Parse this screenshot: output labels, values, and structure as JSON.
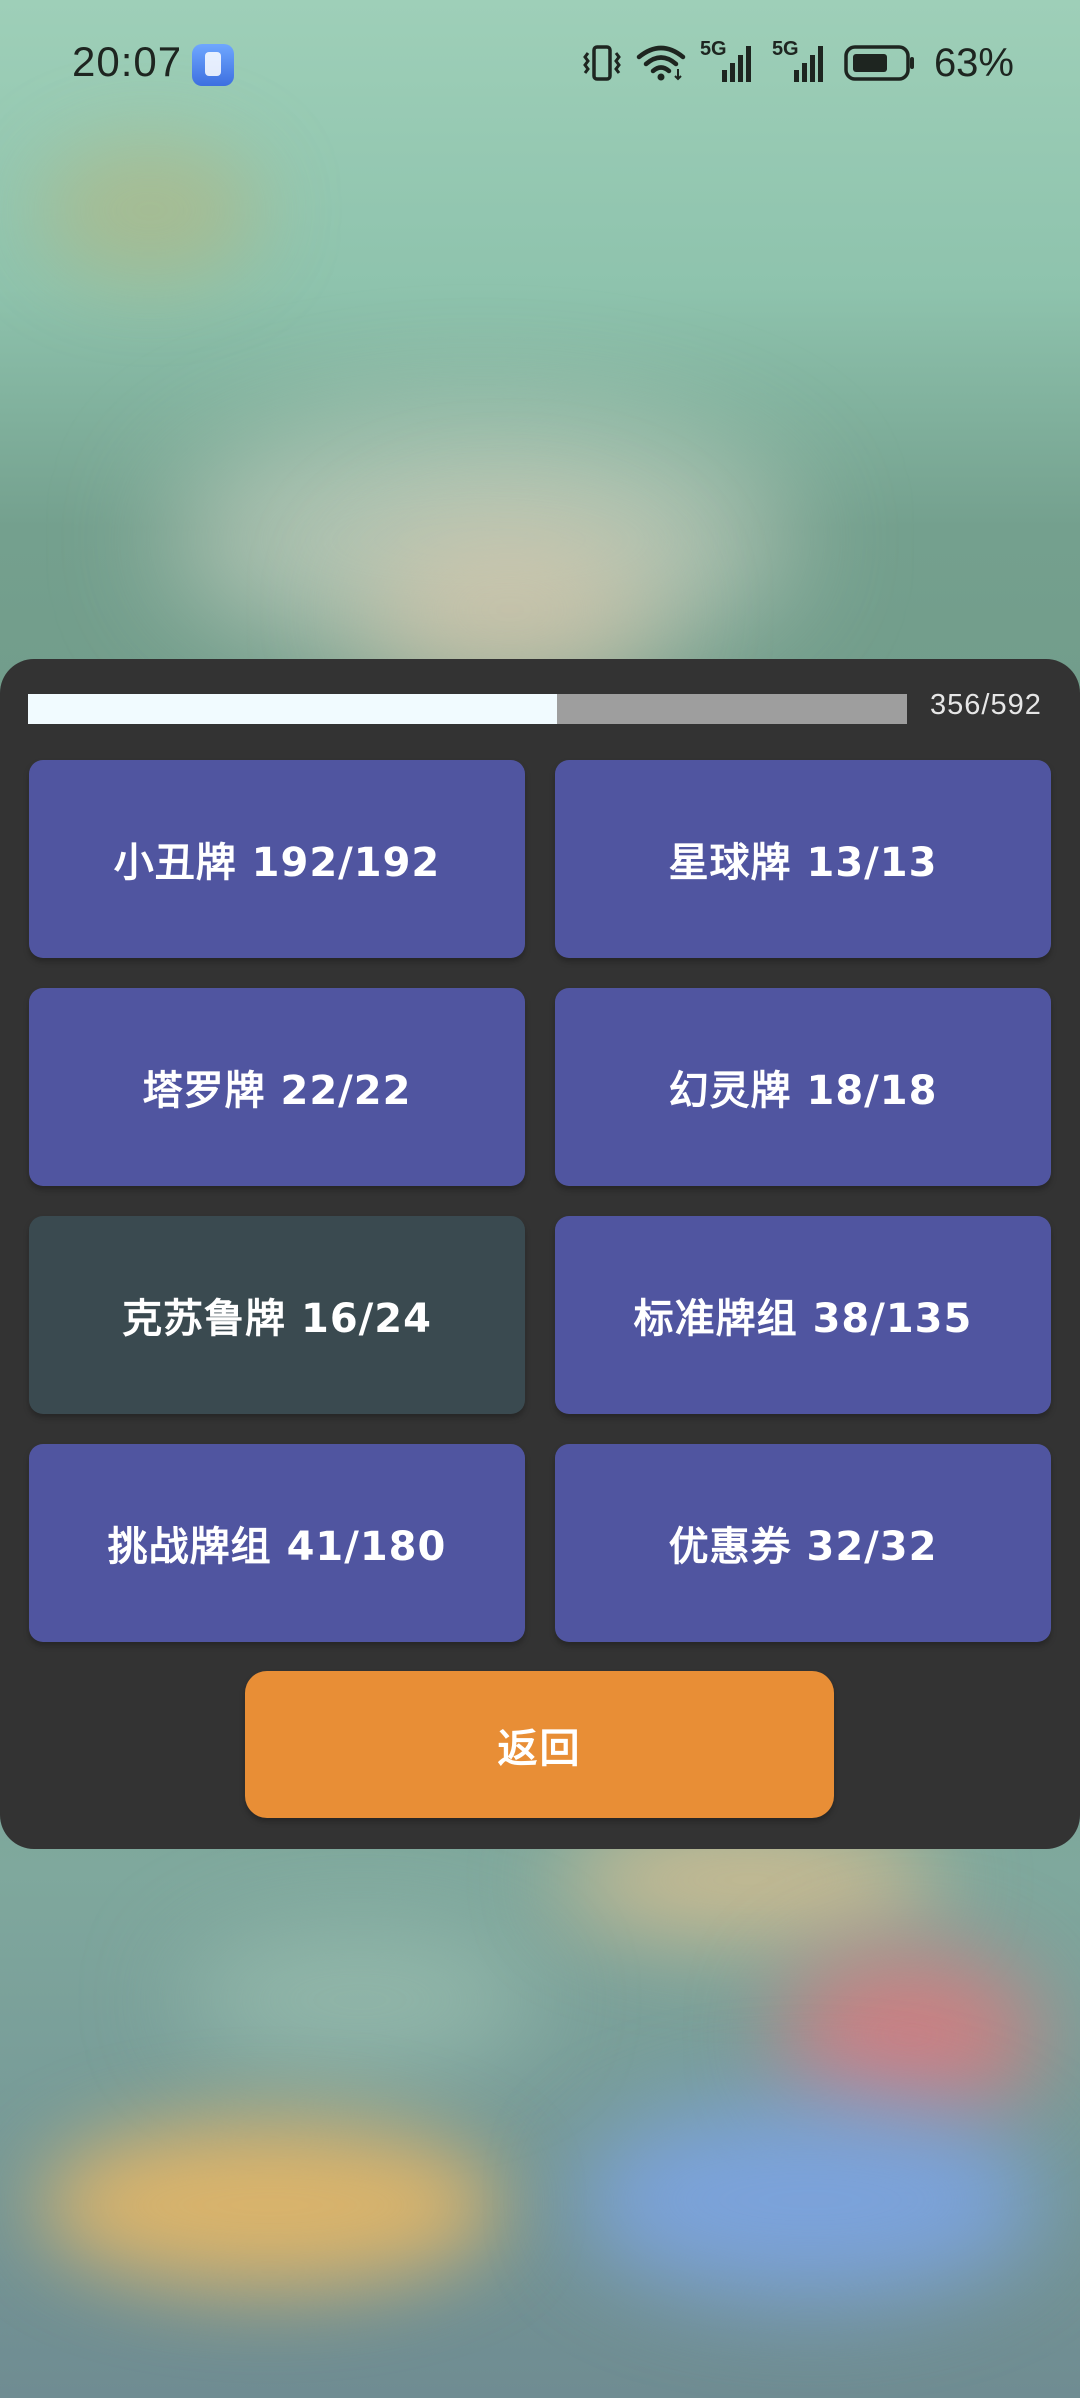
{
  "status_bar": {
    "time": "20:07",
    "battery_percent": "63%",
    "network_label_1": "5G",
    "network_label_2": "5G",
    "icons": [
      "app-notification-icon",
      "vibrate-icon",
      "wifi-icon",
      "signal-5g-icon",
      "signal-5g-icon",
      "battery-icon"
    ]
  },
  "progress": {
    "current": 356,
    "total": 592,
    "label": "356/592",
    "fill_color": "#f1fbff",
    "track_color": "#9e9e9e"
  },
  "categories": [
    {
      "label": "小丑牌 192/192",
      "complete": true,
      "color": "#5055a0"
    },
    {
      "label": "星球牌 13/13",
      "complete": true,
      "color": "#5055a0"
    },
    {
      "label": "塔罗牌 22/22",
      "complete": true,
      "color": "#5055a0"
    },
    {
      "label": "幻灵牌 18/18",
      "complete": true,
      "color": "#5055a0"
    },
    {
      "label": "克苏鲁牌 16/24",
      "complete": false,
      "color": "#3a4a50"
    },
    {
      "label": "标准牌组 38/135",
      "complete": false,
      "color": "#5055a0"
    },
    {
      "label": "挑战牌组 41/180",
      "complete": false,
      "color": "#5055a0"
    },
    {
      "label": "优惠券 32/32",
      "complete": true,
      "color": "#5055a0"
    }
  ],
  "back_button": {
    "label": "返回",
    "color": "#e88e36"
  },
  "colors": {
    "panel_bg": "#333333"
  }
}
